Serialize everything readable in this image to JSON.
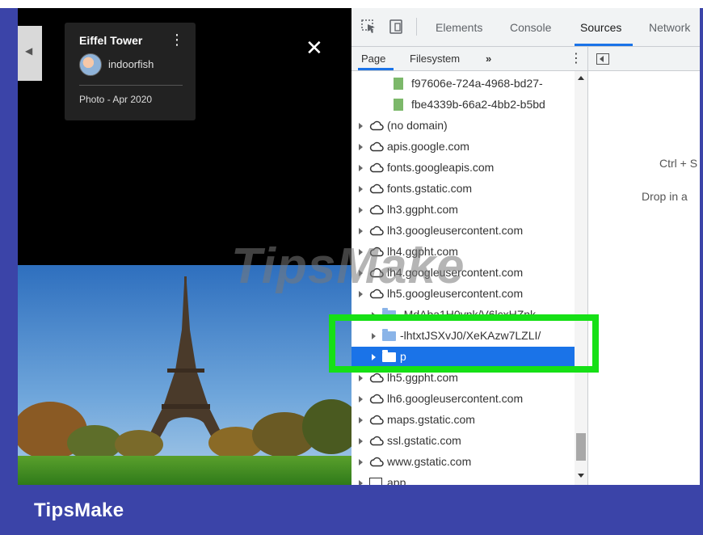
{
  "viewer": {
    "photo_title": "Eiffel Tower",
    "author": "indoorfish",
    "photo_meta": "Photo - Apr 2020",
    "prev_glyph": "◀",
    "close_glyph": "✕",
    "menu_glyph": "⋮"
  },
  "devtools": {
    "tabs": [
      "Elements",
      "Console",
      "Sources",
      "Network"
    ],
    "active_tab": "Sources",
    "navigator_tabs": [
      "Page",
      "Filesystem"
    ],
    "more_glyph": "»",
    "menu_glyph": "⋮",
    "tree": [
      {
        "label": "f97606e-724a-4968-bd27-",
        "icon": "file-icon",
        "level": 3,
        "has_arrow": false
      },
      {
        "label": "fbe4339b-66a2-4bb2-b5bd",
        "icon": "file-icon",
        "level": 3,
        "has_arrow": false
      },
      {
        "label": "(no domain)",
        "icon": "cloud-icon",
        "level": 1,
        "has_arrow": true
      },
      {
        "label": "apis.google.com",
        "icon": "cloud-icon",
        "level": 1,
        "has_arrow": true
      },
      {
        "label": "fonts.googleapis.com",
        "icon": "cloud-icon",
        "level": 1,
        "has_arrow": true
      },
      {
        "label": "fonts.gstatic.com",
        "icon": "cloud-icon",
        "level": 1,
        "has_arrow": true
      },
      {
        "label": "lh3.ggpht.com",
        "icon": "cloud-icon",
        "level": 1,
        "has_arrow": true
      },
      {
        "label": "lh3.googleusercontent.com",
        "icon": "cloud-icon",
        "level": 1,
        "has_arrow": true
      },
      {
        "label": "lh4.ggpht.com",
        "icon": "cloud-icon",
        "level": 1,
        "has_arrow": true
      },
      {
        "label": "lh4.googleusercontent.com",
        "icon": "cloud-icon",
        "level": 1,
        "has_arrow": true
      },
      {
        "label": "lh5.googleusercontent.com",
        "icon": "cloud-icon",
        "level": 1,
        "has_arrow": true
      },
      {
        "label": "-MdAba1H0vnk/V6lcxHZnk",
        "icon": "folder-icon",
        "level": 2,
        "has_arrow": true
      },
      {
        "label": "-lhtxtJSXvJ0/XeKAzw7LZLI/",
        "icon": "folder-icon",
        "level": 2,
        "has_arrow": true
      },
      {
        "label": "p",
        "icon": "folder-icon",
        "level": 2,
        "has_arrow": true,
        "selected": true
      },
      {
        "label": "lh5.ggpht.com",
        "icon": "cloud-icon",
        "level": 1,
        "has_arrow": true
      },
      {
        "label": "lh6.googleusercontent.com",
        "icon": "cloud-icon",
        "level": 1,
        "has_arrow": true
      },
      {
        "label": "maps.gstatic.com",
        "icon": "cloud-icon",
        "level": 1,
        "has_arrow": true
      },
      {
        "label": "ssl.gstatic.com",
        "icon": "cloud-icon",
        "level": 1,
        "has_arrow": true
      },
      {
        "label": "www.gstatic.com",
        "icon": "cloud-icon",
        "level": 1,
        "has_arrow": true
      },
      {
        "label": "app",
        "icon": "window-icon",
        "level": 1,
        "has_arrow": true
      }
    ],
    "editor_shortcut": "Ctrl + S",
    "editor_drop": "Drop in a"
  },
  "watermark": "TipsMake",
  "footer": {
    "brand": "TipsMake"
  },
  "colors": {
    "frame_blue": "#3b44a8",
    "selection_blue": "#1a73e8",
    "highlight_green": "#16e016"
  }
}
